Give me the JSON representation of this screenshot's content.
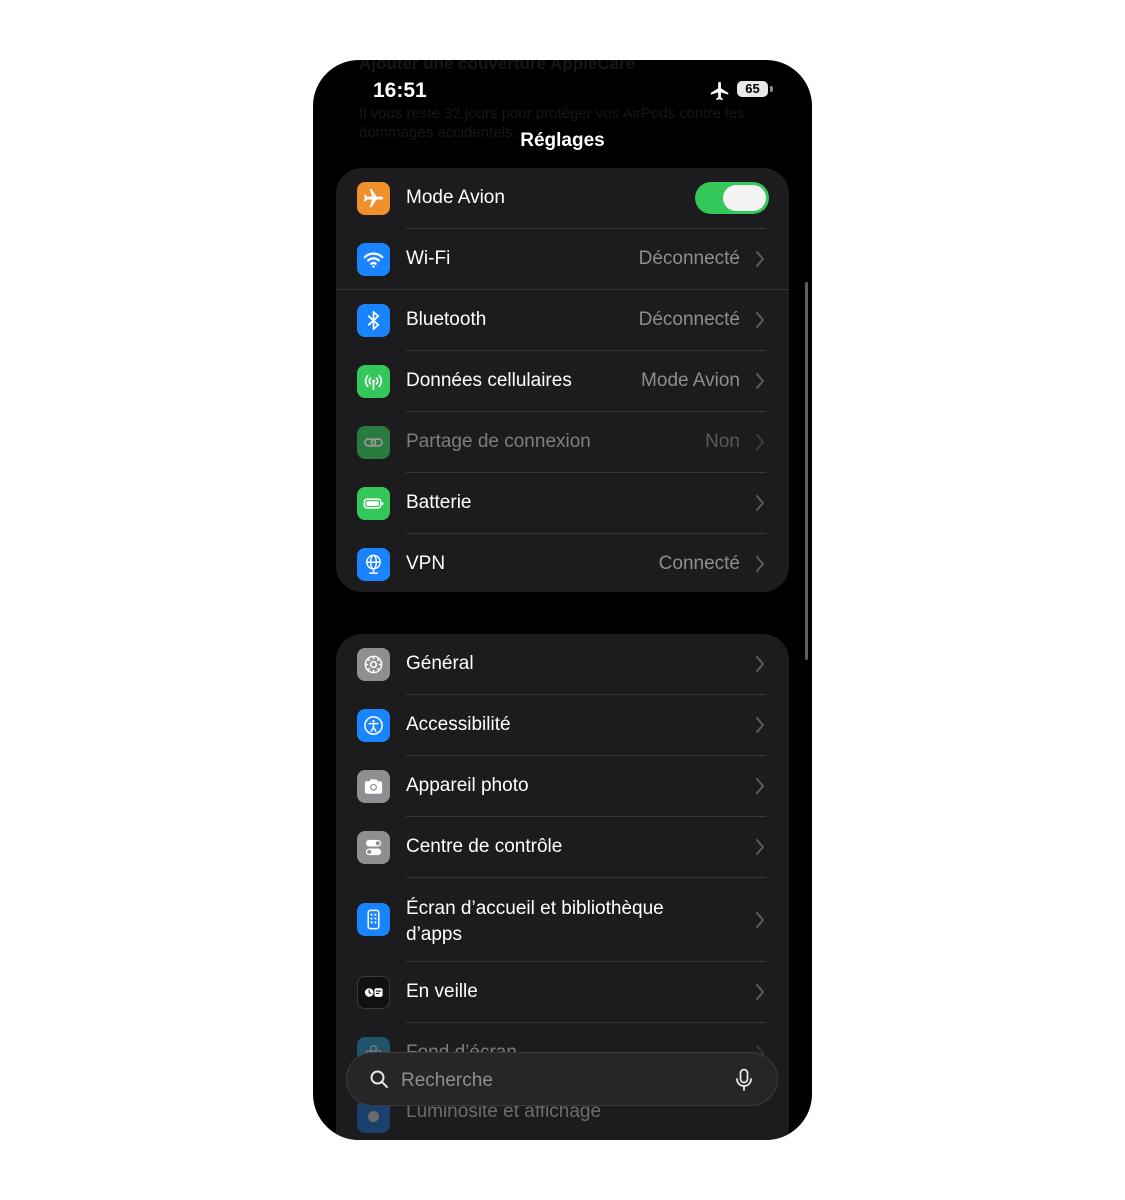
{
  "status_bar": {
    "time": "16:51",
    "battery": "65"
  },
  "background_banner": {
    "title": "Ajouter une couverture AppleCare",
    "body": "Il vous reste 32 jours pour protéger vos AirPods contre les dommages accidentels."
  },
  "nav": {
    "title": "Réglages"
  },
  "group_1": [
    {
      "label": "Mode Avion",
      "value": "",
      "icon": "airplane-icon",
      "color": "#f0902c",
      "toggle": true
    },
    {
      "label": "Wi-Fi",
      "value": "Déconnecté",
      "icon": "wifi-icon",
      "color": "#1a84ff"
    },
    {
      "label": "Bluetooth",
      "value": "Déconnecté",
      "icon": "bluetooth-icon",
      "color": "#1a84ff"
    },
    {
      "label": "Données cellulaires",
      "value": "Mode Avion",
      "icon": "cellular-antenna-icon",
      "color": "#34c759"
    },
    {
      "label": "Partage de connexion",
      "value": "Non",
      "icon": "hotspot-link-icon",
      "color": "#34c759",
      "disabled": true
    },
    {
      "label": "Batterie",
      "value": "",
      "icon": "battery-icon",
      "color": "#34c759"
    },
    {
      "label": "VPN",
      "value": "Connecté",
      "icon": "vpn-globe-icon",
      "color": "#1a84ff"
    }
  ],
  "group_2": [
    {
      "label": "Général",
      "icon": "gear-icon",
      "color": "#8e8e93"
    },
    {
      "label": "Accessibilité",
      "icon": "accessibility-icon",
      "color": "#1a84ff"
    },
    {
      "label": "Appareil photo",
      "icon": "camera-icon",
      "color": "#8e8e93"
    },
    {
      "label": "Centre de contrôle",
      "icon": "control-center-icon",
      "color": "#8e8e93"
    },
    {
      "label": "Écran d’accueil et bibliothèque d’apps",
      "icon": "home-screen-icon",
      "color": "#1a84ff"
    },
    {
      "label": "En veille",
      "icon": "standby-icon",
      "color": "#111111"
    },
    {
      "label": "Fond d’écran",
      "icon": "wallpaper-flower-icon",
      "color": "#2a9fd6"
    }
  ],
  "under_search_row": {
    "label": "Luminosité et affichage",
    "icon": "brightness-icon"
  },
  "search": {
    "placeholder": "Recherche"
  }
}
